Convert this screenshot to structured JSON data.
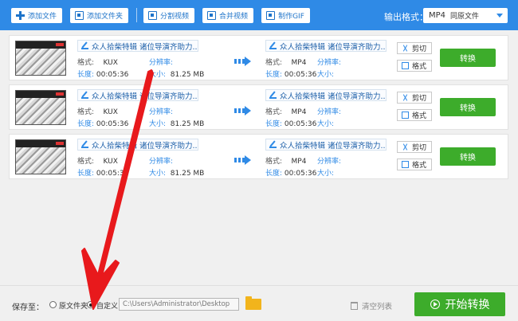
{
  "toolbar": {
    "add_file": "添加文件",
    "add_folder": "添加文件夹",
    "split_video": "分割视频",
    "merge_video": "合并视频",
    "make_gif": "制作GIF",
    "output_format_label": "输出格式：",
    "output_format_value": "MP4",
    "output_format_sub": "同原文件"
  },
  "files": [
    {
      "source_name": "众人拾柴特辑 诸位导演齐助力...",
      "source_format_label": "格式:",
      "source_format": "KUX",
      "source_res_label": "分辨率:",
      "source_res": "",
      "source_duration_label": "长度:",
      "source_duration": "00:05:36",
      "source_size_label": "大小:",
      "source_size": "81.25 MB",
      "target_name": "众人拾柴特辑 诸位导演齐助力...",
      "target_format": "MP4",
      "target_res_label": "分辨率:",
      "target_duration": "00:05:36",
      "target_size_label": "大小:",
      "cut_label": "剪切",
      "format_label": "格式",
      "convert_label": "转换"
    },
    {
      "source_name": "众人拾柴特辑 诸位导演齐助力...",
      "source_format_label": "格式:",
      "source_format": "KUX",
      "source_res_label": "分辨率:",
      "source_res": "",
      "source_duration_label": "长度:",
      "source_duration": "00:05:36",
      "source_size_label": "大小:",
      "source_size": "81.25 MB",
      "target_name": "众人拾柴特辑 诸位导演齐助力...",
      "target_format": "MP4",
      "target_res_label": "分辨率:",
      "target_duration": "00:05:36",
      "target_size_label": "大小:",
      "cut_label": "剪切",
      "format_label": "格式",
      "convert_label": "转换"
    },
    {
      "source_name": "众人拾柴特辑 诸位导演齐助力...",
      "source_format_label": "格式:",
      "source_format": "KUX",
      "source_res_label": "分辨率:",
      "source_res": "",
      "source_duration_label": "长度:",
      "source_duration": "00:05:36",
      "source_size_label": "大小:",
      "source_size": "81.25 MB",
      "target_name": "众人拾柴特辑 诸位导演齐助力...",
      "target_format": "MP4",
      "target_res_label": "分辨率:",
      "target_duration": "00:05:36",
      "target_size_label": "大小:",
      "cut_label": "剪切",
      "format_label": "格式",
      "convert_label": "转换"
    }
  ],
  "bottom": {
    "save_to_label": "保存至：",
    "option_original": "原文件夹",
    "option_custom": "自定义",
    "path_value": "C:\\Users\\Administrator\\Desktop",
    "clear_list": "清空列表",
    "start_convert": "开始转换"
  },
  "colors": {
    "toolbar_blue": "#2f8ae6",
    "accent_green": "#3dac2b",
    "annotation_red": "#e8191c"
  }
}
